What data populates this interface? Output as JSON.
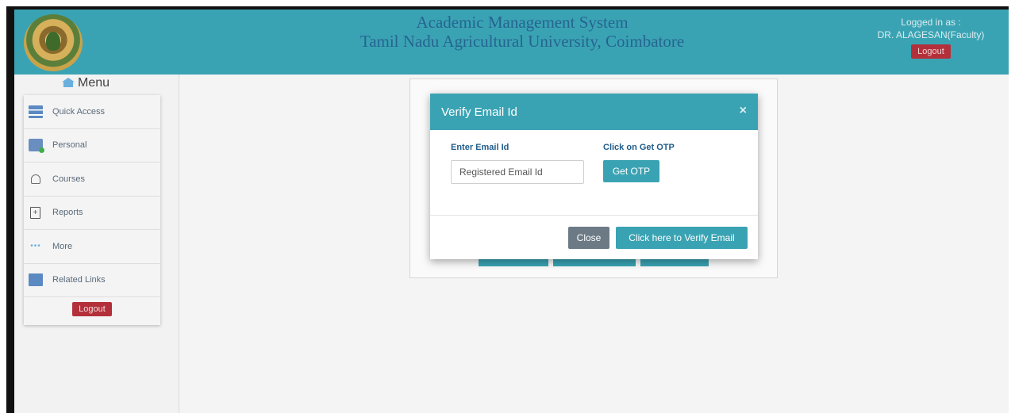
{
  "header": {
    "title_line1": "Academic Management System",
    "title_line2": "Tamil Nadu Agricultural University, Coimbatore",
    "logged_in_label": "Logged in as :",
    "user_name": "DR. ALAGESAN(Faculty)",
    "logout_label": "Logout",
    "logo_icon": "university-seal-icon"
  },
  "sidebar": {
    "menu_title": "Menu",
    "items": [
      {
        "label": "Quick Access",
        "icon": "quick-access-icon"
      },
      {
        "label": "Personal",
        "icon": "personal-icon"
      },
      {
        "label": "Courses",
        "icon": "courses-icon"
      },
      {
        "label": "Reports",
        "icon": "reports-icon"
      },
      {
        "label": "More",
        "icon": "more-dots-icon"
      },
      {
        "label": "Related Links",
        "icon": "related-links-icon"
      }
    ],
    "logout_label": "Logout"
  },
  "modal": {
    "title": "Verify Email Id",
    "close_symbol": "×",
    "email_label": "Enter Email Id",
    "email_placeholder": "Registered Email Id",
    "email_value": "",
    "otp_label": "Click on Get OTP",
    "otp_button": "Get OTP",
    "close_button": "Close",
    "verify_button": "Click here to Verify Email"
  },
  "colors": {
    "accent": "#3aa3b3",
    "logout": "#b3303a",
    "title_text": "#1f4f86",
    "label_text": "#1f5c8a",
    "close_button": "#6c7a86"
  }
}
